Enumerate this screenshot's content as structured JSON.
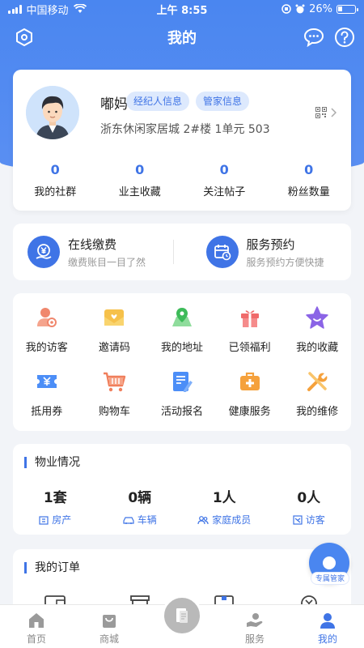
{
  "status_bar": {
    "carrier": "中国移动",
    "time": "上午 8:55",
    "battery": "26%",
    "battery_level": 0.26
  },
  "header": {
    "title": "我的",
    "settings_icon": "hexagon-settings-icon",
    "message_icon": "chat-bubble-icon",
    "help_icon": "question-circle-icon"
  },
  "profile": {
    "name": "嘟妈",
    "tags": [
      "经纪人信息",
      "管家信息"
    ],
    "address": "浙东休闲家居城 2#楼 1单元 503",
    "stats": [
      {
        "value": "0",
        "label": "我的社群"
      },
      {
        "value": "0",
        "label": "业主收藏"
      },
      {
        "value": "0",
        "label": "关注帖子"
      },
      {
        "value": "0",
        "label": "粉丝数量"
      }
    ]
  },
  "services": [
    {
      "title": "在线缴费",
      "subtitle": "缴费账目一目了然",
      "icon": "yen-coin-icon"
    },
    {
      "title": "服务预约",
      "subtitle": "服务预约方便快捷",
      "icon": "calendar-clock-icon"
    }
  ],
  "grid_items": [
    {
      "label": "我的访客",
      "icon": "visitor-icon"
    },
    {
      "label": "邀请码",
      "icon": "invite-envelope-icon"
    },
    {
      "label": "我的地址",
      "icon": "map-pin-icon"
    },
    {
      "label": "已领福利",
      "icon": "gift-icon"
    },
    {
      "label": "我的收藏",
      "icon": "star-icon"
    },
    {
      "label": "抵用券",
      "icon": "coupon-icon"
    },
    {
      "label": "购物车",
      "icon": "cart-icon"
    },
    {
      "label": "活动报名",
      "icon": "signup-doc-icon"
    },
    {
      "label": "健康服务",
      "icon": "medical-kit-icon"
    },
    {
      "label": "我的维修",
      "icon": "repair-tools-icon"
    }
  ],
  "property": {
    "title": "物业情况",
    "items": [
      {
        "value": "1套",
        "label": "房产",
        "icon": "house-icon"
      },
      {
        "value": "0辆",
        "label": "车辆",
        "icon": "car-icon"
      },
      {
        "value": "1人",
        "label": "家庭成员",
        "icon": "people-icon"
      },
      {
        "value": "0人",
        "label": "访客",
        "icon": "visitor-id-icon"
      }
    ]
  },
  "orders": {
    "title": "我的订单"
  },
  "float_button": {
    "label": "专属管家"
  },
  "tab_bar": {
    "tabs": [
      {
        "label": "首页",
        "icon": "home-icon"
      },
      {
        "label": "商城",
        "icon": "shopping-bag-icon"
      },
      {
        "label": "",
        "icon": "document-center-icon"
      },
      {
        "label": "服务",
        "icon": "service-hand-icon"
      },
      {
        "label": "我的",
        "icon": "person-icon"
      }
    ],
    "active_index": 4
  },
  "colors": {
    "primary": "#3f74e6",
    "header_bg": "#4a86f0",
    "page_bg": "#f2f4f8"
  }
}
